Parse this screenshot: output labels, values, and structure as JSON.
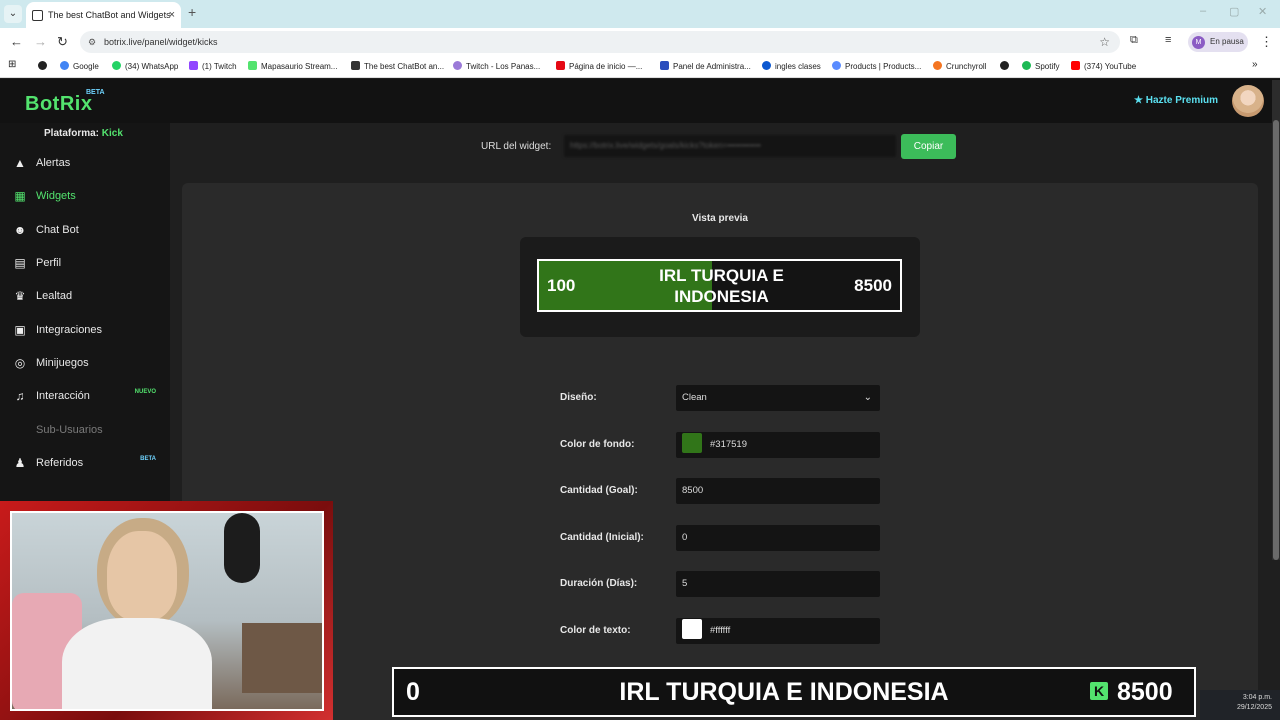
{
  "browser": {
    "tab_title": "The best ChatBot and Widgets",
    "new_tab": "+",
    "url": "botrix.live/panel/widget/kicks",
    "profile_initial": "M",
    "profile_label": "En pausa",
    "bookmarks": [
      "Google",
      "(34) WhatsApp",
      "(1) Twitch",
      "Mapasaurio Stream...",
      "The best ChatBot an...",
      "Twitch - Los Panas...",
      "Página de inicio —...",
      "Panel de Administra...",
      "ingles clases",
      "Products | Products...",
      "Crunchyroll",
      "Spotify",
      "(374) YouTube"
    ]
  },
  "app": {
    "logo": "BotRix",
    "logo_badge": "BETA",
    "premium": "Hazte Premium",
    "platform_label": "Plataforma:",
    "platform_value": "Kick"
  },
  "sidebar": {
    "items": [
      {
        "label": "Alertas",
        "icon": "warning-icon"
      },
      {
        "label": "Widgets",
        "icon": "grid-icon"
      },
      {
        "label": "Chat Bot",
        "icon": "robot-icon"
      },
      {
        "label": "Perfil",
        "icon": "id-card-icon"
      },
      {
        "label": "Lealtad",
        "icon": "trophy-icon"
      },
      {
        "label": "Integraciones",
        "icon": "plug-icon"
      },
      {
        "label": "Minijuegos",
        "icon": "gamepad-icon"
      },
      {
        "label": "Interacción",
        "icon": "music-icon",
        "tag": "NUEVO"
      },
      {
        "label": "Sub-Usuarios",
        "icon": "users-icon"
      },
      {
        "label": "Referidos",
        "icon": "users-icon",
        "tag": "BETA"
      }
    ]
  },
  "widget": {
    "url_label": "URL del widget:",
    "url_value": "https://botrix.live/widgets/goals/kicks?token=••••••••••••",
    "copy_label": "Copiar",
    "preview_title": "Vista previa",
    "goal": {
      "start": "100",
      "title": "IRL TURQUIA E INDONESIA",
      "end": "8500",
      "progress_fraction": 0.48
    }
  },
  "form": {
    "design_label": "Diseño:",
    "design_value": "Clean",
    "bg_color_label": "Color de fondo:",
    "bg_color_value": "#317519",
    "goal_label": "Cantidad (Goal):",
    "goal_value": "8500",
    "initial_label": "Cantidad (Inicial):",
    "initial_value": "0",
    "duration_label": "Duración (Días):",
    "duration_value": "5",
    "text_color_label": "Color de texto:",
    "text_color_value": "#ffffff"
  },
  "stream_overlay": {
    "start": "0",
    "title": "IRL TURQUIA E INDONESIA",
    "end": "8500",
    "logo_letter": "K"
  },
  "taskbar": {
    "time": "3:04 p.m.",
    "date": "29/12/2025"
  }
}
